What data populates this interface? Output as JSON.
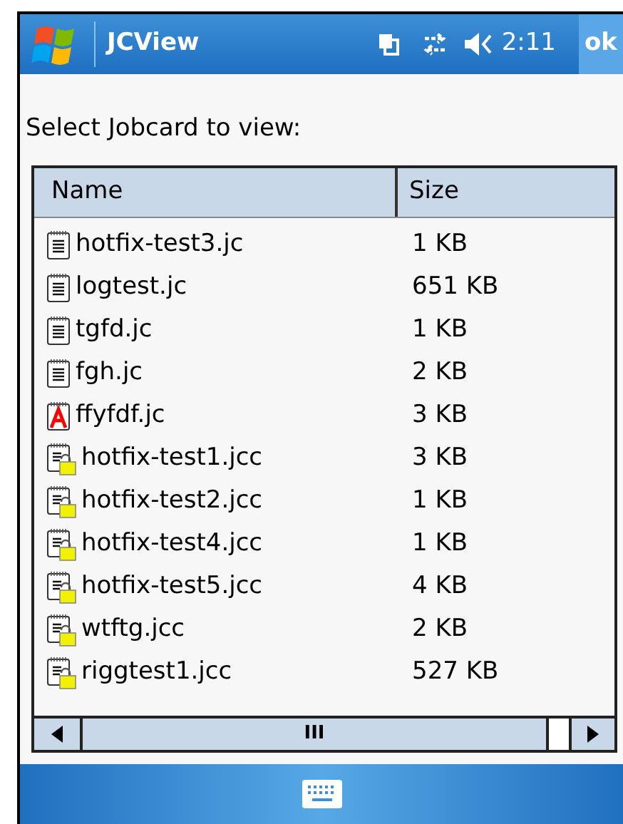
{
  "title_bar": {
    "title": "JCView",
    "time": "2:11",
    "ok": "ok"
  },
  "prompt": "Select Jobcard to view:",
  "table": {
    "columns": [
      "Name",
      "Size"
    ],
    "rows": [
      {
        "kind": "doc",
        "name": "hotfix-test3.jc",
        "size": "1 KB"
      },
      {
        "kind": "doc",
        "name": "logtest.jc",
        "size": "651 KB"
      },
      {
        "kind": "doc",
        "name": "tgfd.jc",
        "size": "1 KB"
      },
      {
        "kind": "doc",
        "name": "fgh.jc",
        "size": "2 KB"
      },
      {
        "kind": "font",
        "name": "ffyfdf.jc",
        "size": "3 KB"
      },
      {
        "kind": "package",
        "name": "hotfix-test1.jcc",
        "size": "3 KB"
      },
      {
        "kind": "package",
        "name": "hotfix-test2.jcc",
        "size": "1 KB"
      },
      {
        "kind": "package",
        "name": "hotfix-test4.jcc",
        "size": "1 KB"
      },
      {
        "kind": "package",
        "name": "hotfix-test5.jcc",
        "size": "4 KB"
      },
      {
        "kind": "package",
        "name": "wtftg.jcc",
        "size": "2 KB"
      },
      {
        "kind": "package",
        "name": "riggtest1.jcc",
        "size": "527 KB"
      }
    ]
  },
  "scrollbar_grip": "III"
}
